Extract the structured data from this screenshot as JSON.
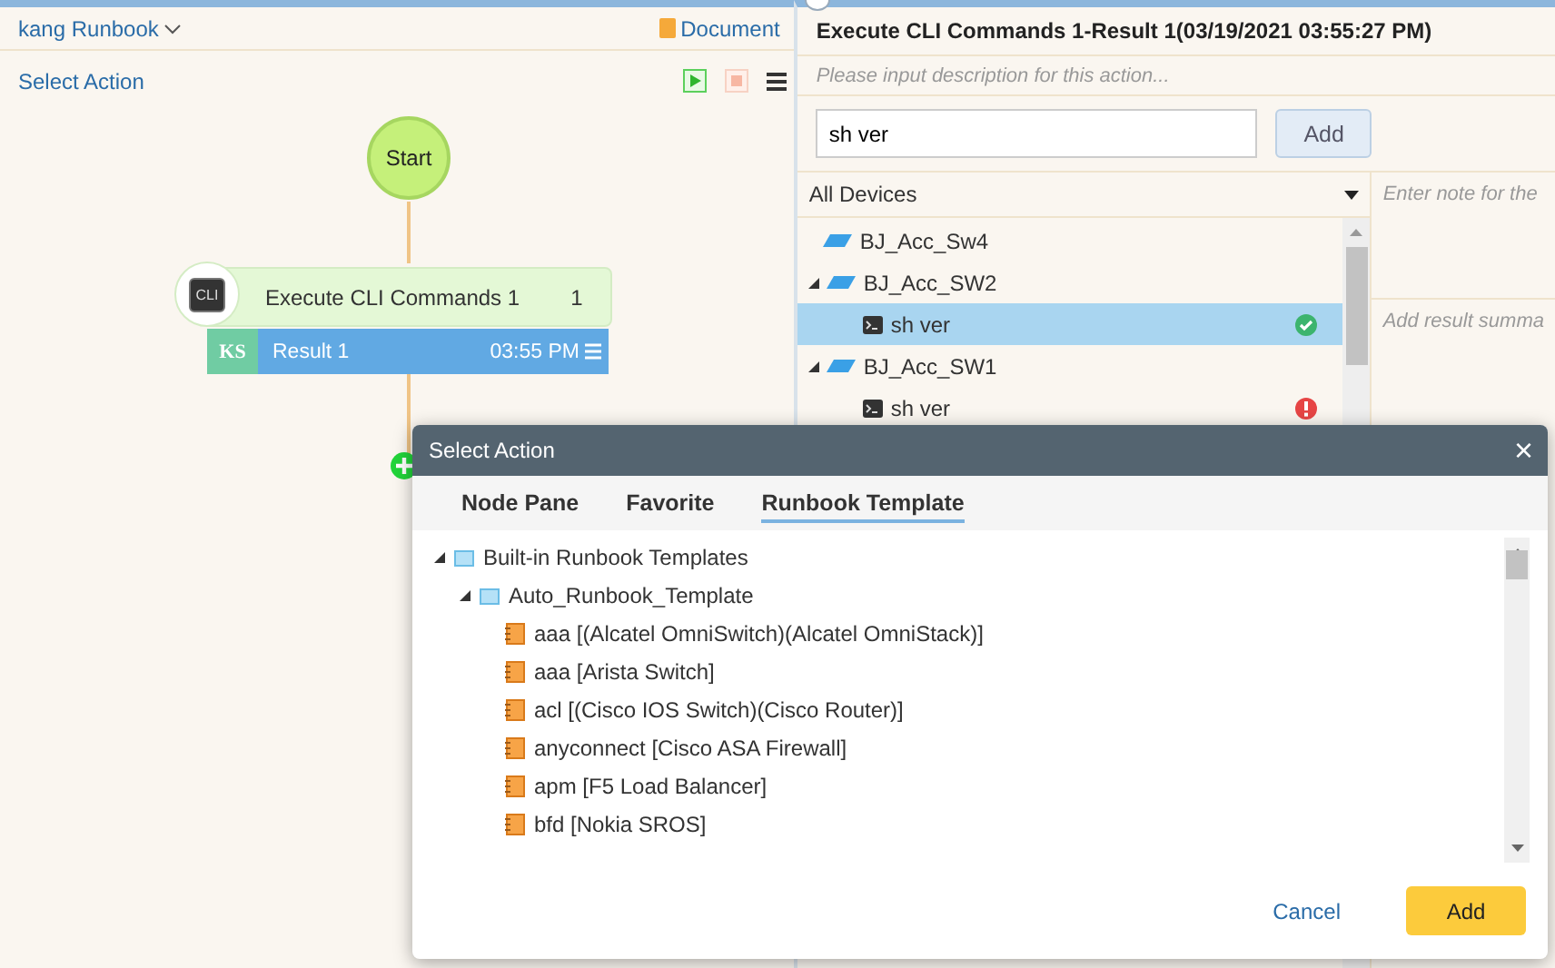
{
  "runbook": {
    "title": "kang Runbook",
    "document": "Document",
    "select_action": "Select Action"
  },
  "flow": {
    "start": "Start",
    "node": {
      "icon": "CLI",
      "title": "Execute CLI Commands 1",
      "count": "1"
    },
    "result": {
      "badge": "KS",
      "label": "Result 1",
      "time": "03:55 PM"
    }
  },
  "detail": {
    "title": "Execute CLI Commands 1-Result 1(03/19/2021 03:55:27 PM)",
    "description_placeholder": "Please input description for this action...",
    "command": "sh ver",
    "add": "Add",
    "device_filter": "All Devices",
    "note_placeholder": "Enter note for the",
    "summary_placeholder": "Add result summa",
    "devices": [
      {
        "name": "BJ_Acc_Sw4",
        "selected": false
      },
      {
        "name": "BJ_Acc_SW2",
        "expanded": true,
        "selected": false,
        "children": [
          {
            "name": "sh ver",
            "failed": false,
            "selected": true
          }
        ]
      },
      {
        "name": "BJ_Acc_SW1",
        "expanded": true,
        "selected": false,
        "children": [
          {
            "name": "sh ver",
            "failed": true,
            "selected": false
          }
        ]
      }
    ]
  },
  "dialog": {
    "title": "Select Action",
    "close": "×",
    "tabs": [
      {
        "label": "Node Pane",
        "selected": false
      },
      {
        "label": "Favorite",
        "selected": false
      },
      {
        "label": "Runbook Template",
        "selected": true
      }
    ],
    "tree": [
      {
        "label": "Built-in Runbook Templates",
        "kind": "folder",
        "expanded": true,
        "children": [
          {
            "label": "Auto_Runbook_Template",
            "kind": "folder",
            "expanded": true,
            "children": [
              {
                "label": "aaa [(Alcatel OmniSwitch)(Alcatel OmniStack)]",
                "kind": "template"
              },
              {
                "label": "aaa [Arista Switch]",
                "kind": "template"
              },
              {
                "label": "acl [(Cisco IOS Switch)(Cisco Router)]",
                "kind": "template"
              },
              {
                "label": "anyconnect [Cisco ASA Firewall]",
                "kind": "template"
              },
              {
                "label": "apm [F5 Load Balancer]",
                "kind": "template"
              },
              {
                "label": "bfd [Nokia SROS]",
                "kind": "template"
              }
            ]
          }
        ]
      }
    ],
    "buttons": {
      "cancel": "Cancel",
      "add": "Add"
    }
  }
}
